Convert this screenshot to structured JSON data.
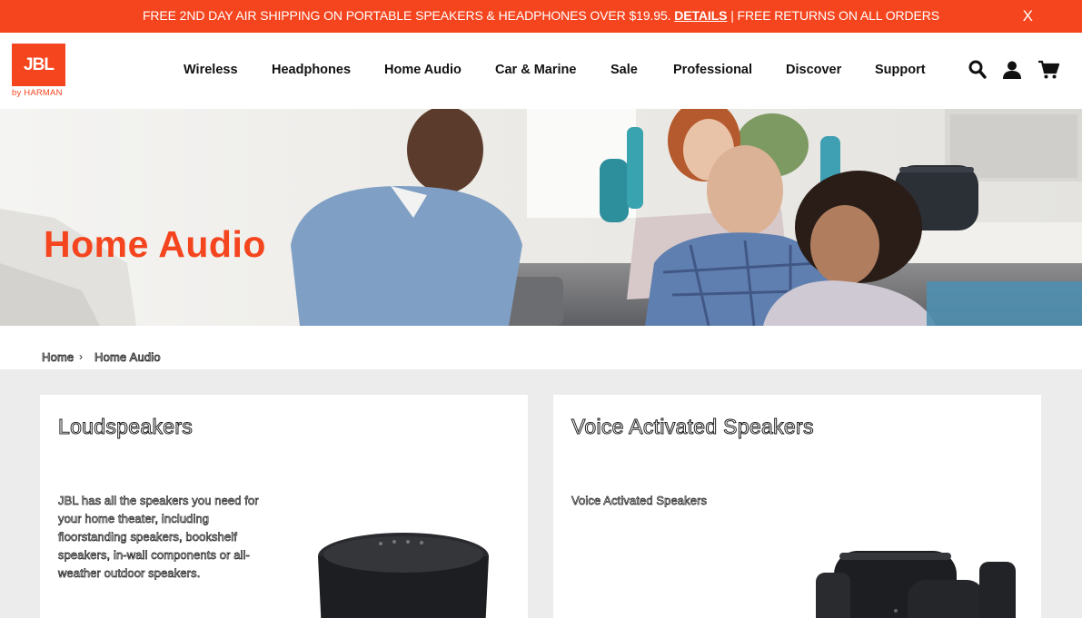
{
  "promo": {
    "text_before": "FREE 2ND DAY AIR SHIPPING ON PORTABLE SPEAKERS & HEADPHONES OVER $19.95.",
    "link": "DETAILS",
    "text_after": "| FREE RETURNS ON ALL ORDERS",
    "close": "X"
  },
  "brand": {
    "logo_text": "JBL",
    "logo_sub": "by HARMAN",
    "accent": "#f4451e"
  },
  "nav": [
    {
      "label": "Wireless"
    },
    {
      "label": "Headphones"
    },
    {
      "label": "Home Audio"
    },
    {
      "label": "Car & Marine"
    },
    {
      "label": "Sale"
    },
    {
      "label": "Professional"
    },
    {
      "label": "Discover"
    },
    {
      "label": "Support"
    }
  ],
  "header_icons": [
    "search-icon",
    "account-icon",
    "cart-icon"
  ],
  "hero": {
    "title": "Home Audio"
  },
  "breadcrumb": {
    "home": "Home",
    "separator": "›",
    "current": "Home Audio"
  },
  "cards": [
    {
      "title": "Loudspeakers",
      "description": "JBL has all the speakers you need for your home theater, including floorstanding speakers, bookshelf speakers, in-wall components or all-weather outdoor speakers."
    },
    {
      "title": "Voice Activated Speakers",
      "description": "Voice Activated Speakers"
    }
  ]
}
